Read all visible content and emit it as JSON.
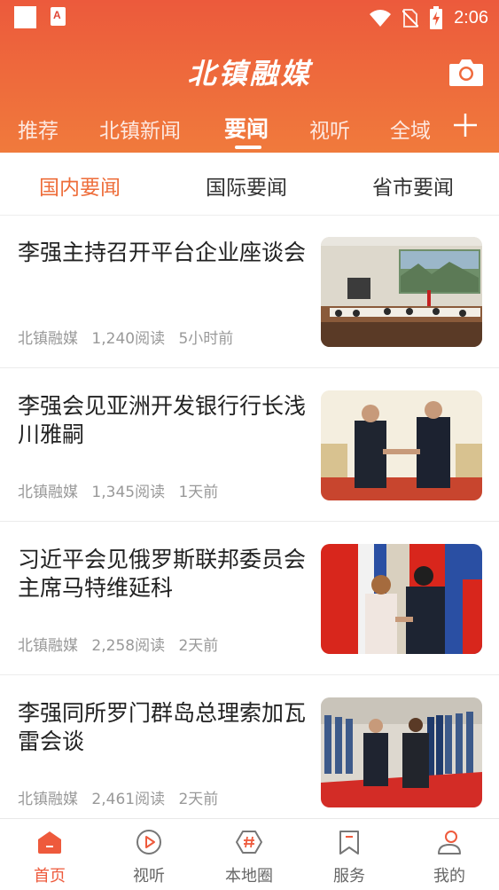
{
  "status_bar": {
    "time": "2:06",
    "app_icon_letter": "A"
  },
  "app": {
    "title": "北镇融媒"
  },
  "nav": {
    "items": [
      {
        "label": "推荐"
      },
      {
        "label": "北镇新闻"
      },
      {
        "label": "要闻"
      },
      {
        "label": "视听"
      },
      {
        "label": "全域"
      }
    ],
    "active_index": 2
  },
  "subtabs": {
    "items": [
      {
        "label": "国内要闻"
      },
      {
        "label": "国际要闻"
      },
      {
        "label": "省市要闻"
      }
    ],
    "active_index": 0
  },
  "articles": [
    {
      "title": "李强主持召开平台企业座谈会",
      "source": "北镇融媒",
      "reads": "1,240阅读",
      "time": "5小时前"
    },
    {
      "title": "李强会见亚洲开发银行行长浅川雅嗣",
      "source": "北镇融媒",
      "reads": "1,345阅读",
      "time": "1天前"
    },
    {
      "title": "习近平会见俄罗斯联邦委员会主席马特维延科",
      "source": "北镇融媒",
      "reads": "2,258阅读",
      "time": "2天前"
    },
    {
      "title": "李强同所罗门群岛总理索加瓦雷会谈",
      "source": "北镇融媒",
      "reads": "2,461阅读",
      "time": "2天前"
    }
  ],
  "tabbar": {
    "items": [
      {
        "label": "首页",
        "icon": "home-icon"
      },
      {
        "label": "视听",
        "icon": "play-icon"
      },
      {
        "label": "本地圈",
        "icon": "hashtag-icon"
      },
      {
        "label": "服务",
        "icon": "bookmark-icon"
      },
      {
        "label": "我的",
        "icon": "user-icon"
      }
    ],
    "active_index": 0
  },
  "colors": {
    "brand": "#ec5a3c",
    "accent": "#ee6d3a",
    "meta": "#999999"
  }
}
